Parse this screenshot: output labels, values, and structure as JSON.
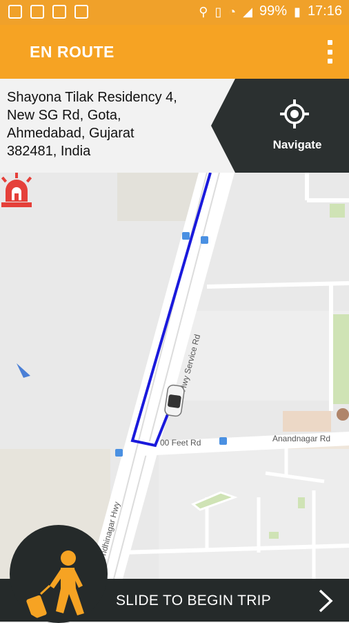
{
  "status_bar": {
    "battery": "99%",
    "time": "17:16",
    "icons": [
      "shield-icon",
      "image-icon",
      "mail-icon",
      "phone-lock-icon",
      "location-icon",
      "vibrate-icon",
      "wifi-icon",
      "signal-icon",
      "battery-icon"
    ]
  },
  "app_bar": {
    "title": "EN ROUTE",
    "menu_icon": "more-vert-icon"
  },
  "destination": {
    "address": "Shayona Tilak Residency 4,\nNew SG Rd, Gota,\nAhmedabad, Gujarat\n382481, India",
    "navigate_label": "Navigate"
  },
  "map": {
    "road_labels": {
      "service_rd": "G Hwy Service Rd",
      "feet_rd": "00 Feet Rd",
      "anandnagar": "Anandnagar Rd",
      "gandhinagar": "ndhinagar Hwy"
    },
    "icons": [
      "siren-icon",
      "car-icon",
      "bus-stop-icon",
      "poi-icon"
    ]
  },
  "bottom": {
    "slide_label": "SLIDE TO BEGIN TRIP",
    "chevron_icon": "chevron-right-icon",
    "walker_icon": "traveler-luggage-icon"
  },
  "colors": {
    "accent": "#f6a323",
    "dark": "#252a2a",
    "route": "#1a1adc",
    "siren": "#e5403a"
  }
}
